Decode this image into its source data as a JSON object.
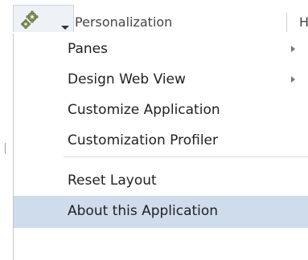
{
  "toolbar": {
    "gear_icon": "gears-icon",
    "dropdown_icon": "caret-down-icon"
  },
  "tabs": [
    {
      "label": "Personalization"
    },
    {
      "label": "H"
    }
  ],
  "menu": {
    "items": [
      {
        "label": "Panes",
        "submenu": true
      },
      {
        "label": "Design Web View",
        "submenu": true
      },
      {
        "label": "Customize Application",
        "submenu": false
      },
      {
        "label": "Customization Profiler",
        "submenu": false
      },
      {
        "label": "Reset Layout",
        "submenu": false
      },
      {
        "label": "About this Application",
        "submenu": false,
        "highlighted": true
      }
    ]
  },
  "colors": {
    "highlight": "#cfdcec",
    "gear_fill": "#8c9a62"
  }
}
